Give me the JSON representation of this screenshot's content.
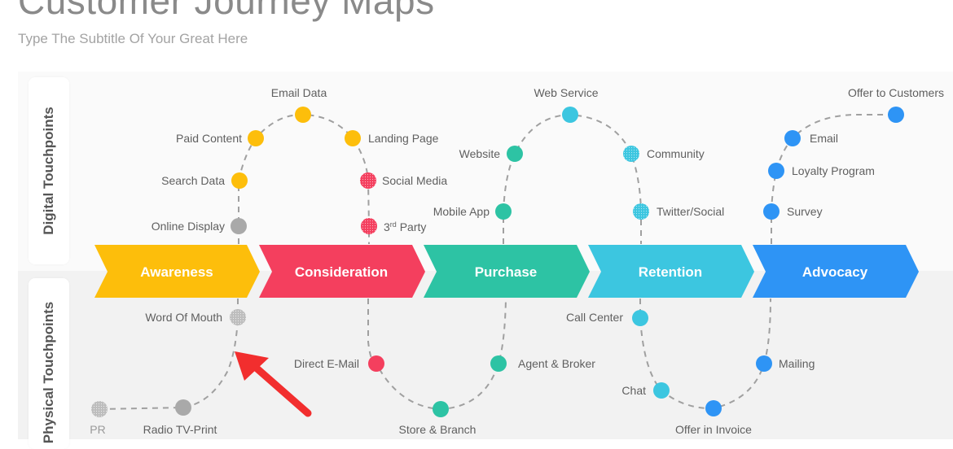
{
  "header": {
    "title": "Customer Journey Maps",
    "subtitle": "Type The Subtitle Of Your Great Here"
  },
  "rows": {
    "digital_label": "Digital Touchpoints",
    "physical_label": "Physical Touchpoints"
  },
  "colors": {
    "awareness": "#FDBE0B",
    "consideration": "#F43F5E",
    "purchase": "#2DC3A4",
    "retention": "#3CC6E0",
    "advocacy": "#2E94F5",
    "neutral": "#a9a9a9",
    "annotation_arrow": "#F22E2E"
  },
  "stages": [
    {
      "id": "awareness",
      "label": "Awareness"
    },
    {
      "id": "consideration",
      "label": "Consideration"
    },
    {
      "id": "purchase",
      "label": "Purchase"
    },
    {
      "id": "retention",
      "label": "Retention"
    },
    {
      "id": "advocacy",
      "label": "Advocacy"
    }
  ],
  "digital_touchpoints": [
    {
      "label": "Online Display",
      "stage": "awareness",
      "color": "neutral",
      "pattern": false
    },
    {
      "label": "Search Data",
      "stage": "awareness",
      "color": "awareness",
      "pattern": false
    },
    {
      "label": "Paid Content",
      "stage": "awareness",
      "color": "awareness",
      "pattern": false
    },
    {
      "label": "Email Data",
      "stage": "awareness",
      "color": "awareness",
      "pattern": false
    },
    {
      "label": "Landing Page",
      "stage": "awareness",
      "color": "awareness",
      "pattern": false
    },
    {
      "label": "Social Media",
      "stage": "consideration",
      "color": "consideration",
      "pattern": true
    },
    {
      "label": "3rd Party",
      "stage": "consideration",
      "color": "consideration",
      "pattern": true
    },
    {
      "label": "Mobile App",
      "stage": "purchase",
      "color": "purchase",
      "pattern": false
    },
    {
      "label": "Website",
      "stage": "purchase",
      "color": "purchase",
      "pattern": false
    },
    {
      "label": "Web Service",
      "stage": "retention",
      "color": "retention",
      "pattern": false
    },
    {
      "label": "Community",
      "stage": "retention",
      "color": "retention",
      "pattern": true
    },
    {
      "label": "Twitter/Social",
      "stage": "retention",
      "color": "retention",
      "pattern": true
    },
    {
      "label": "Survey",
      "stage": "advocacy",
      "color": "advocacy",
      "pattern": false
    },
    {
      "label": "Loyalty Program",
      "stage": "advocacy",
      "color": "advocacy",
      "pattern": false
    },
    {
      "label": "Email",
      "stage": "advocacy",
      "color": "advocacy",
      "pattern": false
    },
    {
      "label": "Offer to Customers",
      "stage": "advocacy",
      "color": "advocacy",
      "pattern": false
    }
  ],
  "physical_touchpoints": [
    {
      "label": "Word Of Mouth",
      "stage": "awareness",
      "color": "neutral",
      "pattern": true
    },
    {
      "label": "Radio TV-Print",
      "stage": "awareness",
      "color": "neutral",
      "pattern": false
    },
    {
      "label": "PR",
      "stage": "awareness",
      "color": "neutral",
      "pattern": true
    },
    {
      "label": "Direct E-Mail",
      "stage": "consideration",
      "color": "consideration",
      "pattern": false
    },
    {
      "label": "Store & Branch",
      "stage": "purchase",
      "color": "purchase",
      "pattern": false
    },
    {
      "label": "Agent & Broker",
      "stage": "purchase",
      "color": "purchase",
      "pattern": false
    },
    {
      "label": "Call Center",
      "stage": "retention",
      "color": "retention",
      "pattern": false
    },
    {
      "label": "Chat",
      "stage": "retention",
      "color": "retention",
      "pattern": false
    },
    {
      "label": "Offer in Invoice",
      "stage": "advocacy",
      "color": "advocacy",
      "pattern": false
    },
    {
      "label": "Mailing",
      "stage": "advocacy",
      "color": "advocacy",
      "pattern": false
    }
  ],
  "third_party": {
    "base": "3",
    "sup": "rd",
    "rest": " Party"
  }
}
